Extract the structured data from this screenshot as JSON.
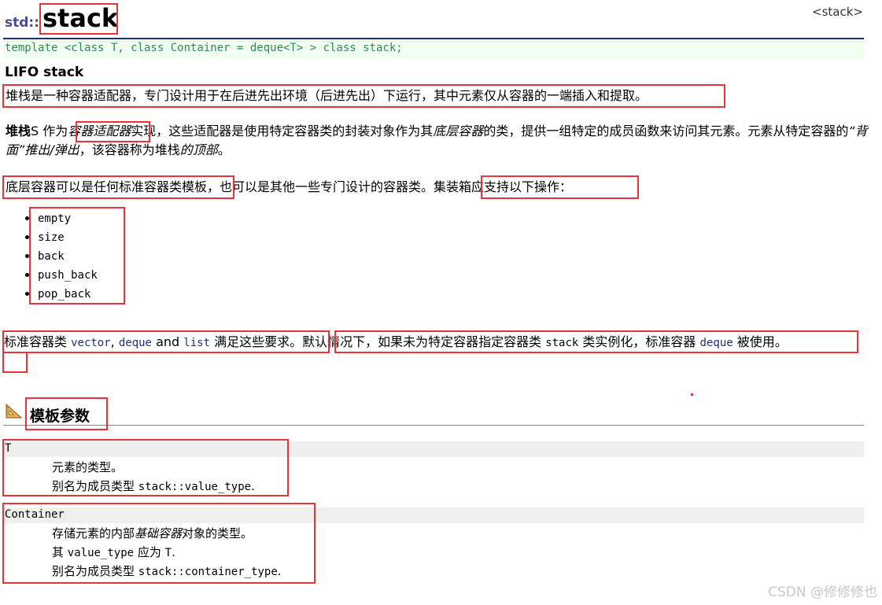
{
  "header": {
    "namespace": "std::",
    "name": "stack",
    "tag": "<stack>",
    "template_decl": "template <class T, class Container = deque<T> > class stack;"
  },
  "intro": {
    "title": "LIFO stack",
    "para1": "堆栈是一种容器适配器，专门设计用于在后进先出环境（后进先出）下运行，其中元素仅从容器的一端插入和提取。",
    "para2": {
      "bold": "堆栈",
      "t1": "S 作为",
      "italic1": "容器适配器",
      "t2": "实现，这些适配器是使用特定容器类的封装对象作为其",
      "italic2": "底层容器",
      "t3": "的类，提供一组特定的成员函数来访问其元素。元素从特定容器的",
      "italic3": "“背面”推出/弹出",
      "t4": "，该容器称为堆栈",
      "italic4": "的顶部",
      "t5": "。"
    },
    "para3": {
      "t1": "底层容器可以是任何标准容器类模板",
      "t2": "，也可以是其他一些专门设计的容器类。",
      "t3": "集装箱应支持以下操作："
    }
  },
  "operations": [
    "empty",
    "size",
    "back",
    "push_back",
    "pop_back"
  ],
  "para4": {
    "t1": "标准容器类 ",
    "c1": "vector",
    "t2": ", ",
    "c2": "deque",
    "t3": " and ",
    "c3": "list",
    "t4": " 满足这些要求。",
    "t5": "默认情况下，如果未为特定容器指定容器类 ",
    "c4": "stack",
    "t6": " 类实例化，标准容器 ",
    "c5": "deque",
    "t7": " 被使用。"
  },
  "params": {
    "heading": "模板参数",
    "t": {
      "name": "T",
      "line1": "元素的类型。",
      "line2_text": "别名为成员类型 ",
      "line2_code": "stack::value_type",
      "line2_end": "."
    },
    "container": {
      "name": "Container",
      "line1_text": "存储元素的内部",
      "line1_italic": "基础容器",
      "line1_end": "对象的类型。",
      "line2_text": "其 ",
      "line2_code": "value_type",
      "line2_mid": " 应为 ",
      "line2_code2": "T",
      "line2_end": ".",
      "line3_text": "别名为成员类型 ",
      "line3_code": "stack::container_type",
      "line3_end": "."
    }
  },
  "watermark": "CSDN @修修修也"
}
